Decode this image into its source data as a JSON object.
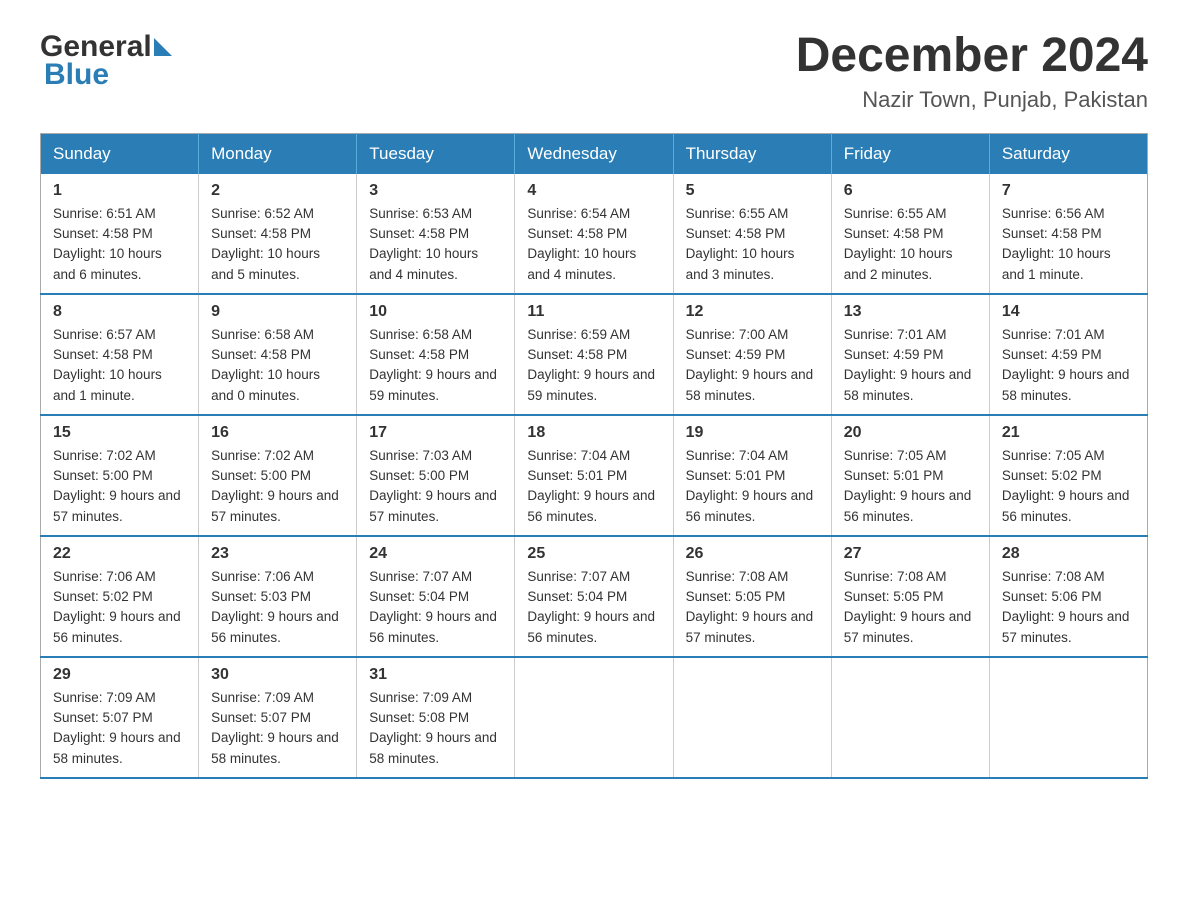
{
  "header": {
    "logo_general": "General",
    "logo_blue": "Blue",
    "title": "December 2024",
    "location": "Nazir Town, Punjab, Pakistan"
  },
  "weekdays": [
    "Sunday",
    "Monday",
    "Tuesday",
    "Wednesday",
    "Thursday",
    "Friday",
    "Saturday"
  ],
  "weeks": [
    [
      {
        "num": "1",
        "sunrise": "6:51 AM",
        "sunset": "4:58 PM",
        "daylight": "10 hours and 6 minutes."
      },
      {
        "num": "2",
        "sunrise": "6:52 AM",
        "sunset": "4:58 PM",
        "daylight": "10 hours and 5 minutes."
      },
      {
        "num": "3",
        "sunrise": "6:53 AM",
        "sunset": "4:58 PM",
        "daylight": "10 hours and 4 minutes."
      },
      {
        "num": "4",
        "sunrise": "6:54 AM",
        "sunset": "4:58 PM",
        "daylight": "10 hours and 4 minutes."
      },
      {
        "num": "5",
        "sunrise": "6:55 AM",
        "sunset": "4:58 PM",
        "daylight": "10 hours and 3 minutes."
      },
      {
        "num": "6",
        "sunrise": "6:55 AM",
        "sunset": "4:58 PM",
        "daylight": "10 hours and 2 minutes."
      },
      {
        "num": "7",
        "sunrise": "6:56 AM",
        "sunset": "4:58 PM",
        "daylight": "10 hours and 1 minute."
      }
    ],
    [
      {
        "num": "8",
        "sunrise": "6:57 AM",
        "sunset": "4:58 PM",
        "daylight": "10 hours and 1 minute."
      },
      {
        "num": "9",
        "sunrise": "6:58 AM",
        "sunset": "4:58 PM",
        "daylight": "10 hours and 0 minutes."
      },
      {
        "num": "10",
        "sunrise": "6:58 AM",
        "sunset": "4:58 PM",
        "daylight": "9 hours and 59 minutes."
      },
      {
        "num": "11",
        "sunrise": "6:59 AM",
        "sunset": "4:58 PM",
        "daylight": "9 hours and 59 minutes."
      },
      {
        "num": "12",
        "sunrise": "7:00 AM",
        "sunset": "4:59 PM",
        "daylight": "9 hours and 58 minutes."
      },
      {
        "num": "13",
        "sunrise": "7:01 AM",
        "sunset": "4:59 PM",
        "daylight": "9 hours and 58 minutes."
      },
      {
        "num": "14",
        "sunrise": "7:01 AM",
        "sunset": "4:59 PM",
        "daylight": "9 hours and 58 minutes."
      }
    ],
    [
      {
        "num": "15",
        "sunrise": "7:02 AM",
        "sunset": "5:00 PM",
        "daylight": "9 hours and 57 minutes."
      },
      {
        "num": "16",
        "sunrise": "7:02 AM",
        "sunset": "5:00 PM",
        "daylight": "9 hours and 57 minutes."
      },
      {
        "num": "17",
        "sunrise": "7:03 AM",
        "sunset": "5:00 PM",
        "daylight": "9 hours and 57 minutes."
      },
      {
        "num": "18",
        "sunrise": "7:04 AM",
        "sunset": "5:01 PM",
        "daylight": "9 hours and 56 minutes."
      },
      {
        "num": "19",
        "sunrise": "7:04 AM",
        "sunset": "5:01 PM",
        "daylight": "9 hours and 56 minutes."
      },
      {
        "num": "20",
        "sunrise": "7:05 AM",
        "sunset": "5:01 PM",
        "daylight": "9 hours and 56 minutes."
      },
      {
        "num": "21",
        "sunrise": "7:05 AM",
        "sunset": "5:02 PM",
        "daylight": "9 hours and 56 minutes."
      }
    ],
    [
      {
        "num": "22",
        "sunrise": "7:06 AM",
        "sunset": "5:02 PM",
        "daylight": "9 hours and 56 minutes."
      },
      {
        "num": "23",
        "sunrise": "7:06 AM",
        "sunset": "5:03 PM",
        "daylight": "9 hours and 56 minutes."
      },
      {
        "num": "24",
        "sunrise": "7:07 AM",
        "sunset": "5:04 PM",
        "daylight": "9 hours and 56 minutes."
      },
      {
        "num": "25",
        "sunrise": "7:07 AM",
        "sunset": "5:04 PM",
        "daylight": "9 hours and 56 minutes."
      },
      {
        "num": "26",
        "sunrise": "7:08 AM",
        "sunset": "5:05 PM",
        "daylight": "9 hours and 57 minutes."
      },
      {
        "num": "27",
        "sunrise": "7:08 AM",
        "sunset": "5:05 PM",
        "daylight": "9 hours and 57 minutes."
      },
      {
        "num": "28",
        "sunrise": "7:08 AM",
        "sunset": "5:06 PM",
        "daylight": "9 hours and 57 minutes."
      }
    ],
    [
      {
        "num": "29",
        "sunrise": "7:09 AM",
        "sunset": "5:07 PM",
        "daylight": "9 hours and 58 minutes."
      },
      {
        "num": "30",
        "sunrise": "7:09 AM",
        "sunset": "5:07 PM",
        "daylight": "9 hours and 58 minutes."
      },
      {
        "num": "31",
        "sunrise": "7:09 AM",
        "sunset": "5:08 PM",
        "daylight": "9 hours and 58 minutes."
      },
      null,
      null,
      null,
      null
    ]
  ],
  "labels": {
    "sunrise": "Sunrise: ",
    "sunset": "Sunset: ",
    "daylight": "Daylight: "
  }
}
